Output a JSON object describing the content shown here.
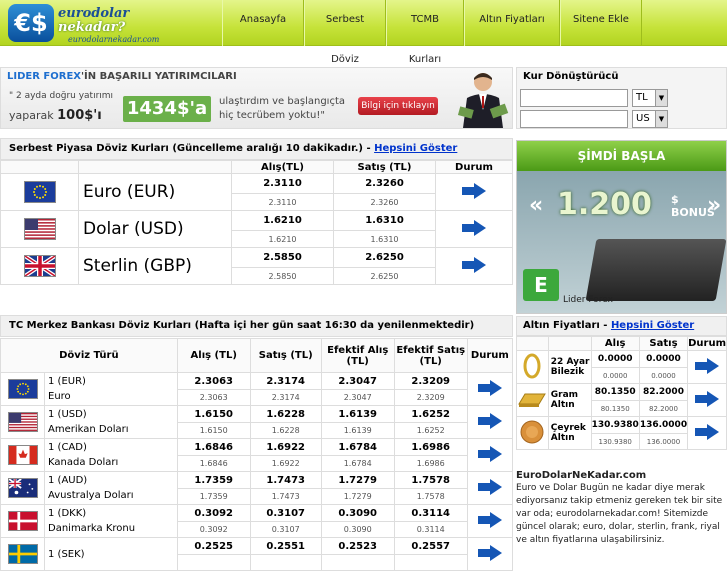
{
  "header": {
    "logo_line1": "eurodolar",
    "logo_line2": "nekadar?",
    "logo_line3": "eurodolarnekadar.com",
    "logo_mark": "€$",
    "nav": [
      "Anasayfa",
      "Serbest Döviz",
      "TCMB Kurları",
      "Altın Fiyatları",
      "Sitene Ekle"
    ]
  },
  "ad": {
    "brand_a": "LIDER FOREX",
    "brand_b": "'İN BAŞARILI YATIRIMCILARI",
    "line1": "\" 2 ayda doğru yatırımı",
    "line2a": "yaparak ",
    "line2b": "100$'ı",
    "amount": "1434$'a",
    "right1": "ulaştırdım ve başlangıçta",
    "right2": "hiç tecrübem yoktu!\"",
    "cta": "Bilgi için tıklayın"
  },
  "converter": {
    "title": "Kur Dönüştürücü",
    "from_value": "",
    "from_cur": "TL",
    "to_value": "",
    "to_cur": "US"
  },
  "free_market": {
    "title": "Serbest Piyasa Döviz Kurları (Güncelleme aralığı 10 dakikadır.) - ",
    "link": "Hepsini Göster",
    "headers": [
      "Alış(TL)",
      "Satış (TL)",
      "Durum"
    ],
    "rows": [
      {
        "name": "Euro (EUR)",
        "buy": "2.3110",
        "sell": "2.3260",
        "buy2": "2.3110",
        "sell2": "2.3260",
        "flag": "eu"
      },
      {
        "name": "Dolar (USD)",
        "buy": "1.6210",
        "sell": "1.6310",
        "buy2": "1.6210",
        "sell2": "1.6310",
        "flag": "us"
      },
      {
        "name": "Sterlin (GBP)",
        "buy": "2.5850",
        "sell": "2.6250",
        "buy2": "2.5850",
        "sell2": "2.6250",
        "flag": "gb"
      }
    ]
  },
  "tcmb": {
    "title": "TC Merkez Bankası Döviz Kurları (Hafta içi her gün saat 16:30 da yenilenmektedir)",
    "headers": [
      "Döviz Türü",
      "Alış (TL)",
      "Satış (TL)",
      "Efektif Alış (TL)",
      "Efektif Satış (TL)",
      "Durum"
    ],
    "rows": [
      {
        "code": "1 (EUR)",
        "name": "Euro",
        "a": "2.3063",
        "s": "2.3174",
        "ea": "2.3047",
        "es": "2.3209",
        "a2": "2.3063",
        "s2": "2.3174",
        "ea2": "2.3047",
        "es2": "2.3209",
        "flag": "eu"
      },
      {
        "code": "1 (USD)",
        "name": "Amerikan Doları",
        "a": "1.6150",
        "s": "1.6228",
        "ea": "1.6139",
        "es": "1.6252",
        "a2": "1.6150",
        "s2": "1.6228",
        "ea2": "1.6139",
        "es2": "1.6252",
        "flag": "us"
      },
      {
        "code": "1 (CAD)",
        "name": "Kanada Doları",
        "a": "1.6846",
        "s": "1.6922",
        "ea": "1.6784",
        "es": "1.6986",
        "a2": "1.6846",
        "s2": "1.6922",
        "ea2": "1.6784",
        "es2": "1.6986",
        "flag": "ca"
      },
      {
        "code": "1 (AUD)",
        "name": "Avustralya Doları",
        "a": "1.7359",
        "s": "1.7473",
        "ea": "1.7279",
        "es": "1.7578",
        "a2": "1.7359",
        "s2": "1.7473",
        "ea2": "1.7279",
        "es2": "1.7578",
        "flag": "au"
      },
      {
        "code": "1 (DKK)",
        "name": "Danimarka Kronu",
        "a": "0.3092",
        "s": "0.3107",
        "ea": "0.3090",
        "es": "0.3114",
        "a2": "0.3092",
        "s2": "0.3107",
        "ea2": "0.3090",
        "es2": "0.3114",
        "flag": "dk"
      },
      {
        "code": "1 (SEK)",
        "name": "",
        "a": "0.2525",
        "s": "0.2551",
        "ea": "0.2523",
        "es": "0.2557",
        "a2": "",
        "s2": "",
        "ea2": "",
        "es2": "",
        "flag": "se"
      }
    ]
  },
  "promo": {
    "start": "ŞİMDİ BAŞLA",
    "amount": "1.200",
    "currency": "$",
    "bonus": "BONUS",
    "brand": "Lider Forex"
  },
  "gold": {
    "title": "Altın Fiyatları - ",
    "link": "Hepsini Göster",
    "headers": [
      "Alış",
      "Satış",
      "Durum"
    ],
    "rows": [
      {
        "name": "22 Ayar Bilezik",
        "buy": "0.0000",
        "sell": "0.0000",
        "buy2": "0.0000",
        "sell2": "0.0000"
      },
      {
        "name": "Gram Altın",
        "buy": "80.1350",
        "sell": "82.2000",
        "buy2": "80.1350",
        "sell2": "82.2000"
      },
      {
        "name": "Çeyrek Altın",
        "buy": "130.9380",
        "sell": "136.0000",
        "buy2": "130.9380",
        "sell2": "136.0000"
      }
    ]
  },
  "about": {
    "title": "EuroDolarNeKadar.com",
    "text": "Euro ve Dolar Bugün ne kadar diye merak ediyorsanız takip etmeniz gereken tek bir site var oda; eurodolarnekadar.com! Sitemizde güncel olarak; euro, dolar, sterlin, frank, riyal ve altın fiyatlarına ulaşabilirsiniz."
  }
}
